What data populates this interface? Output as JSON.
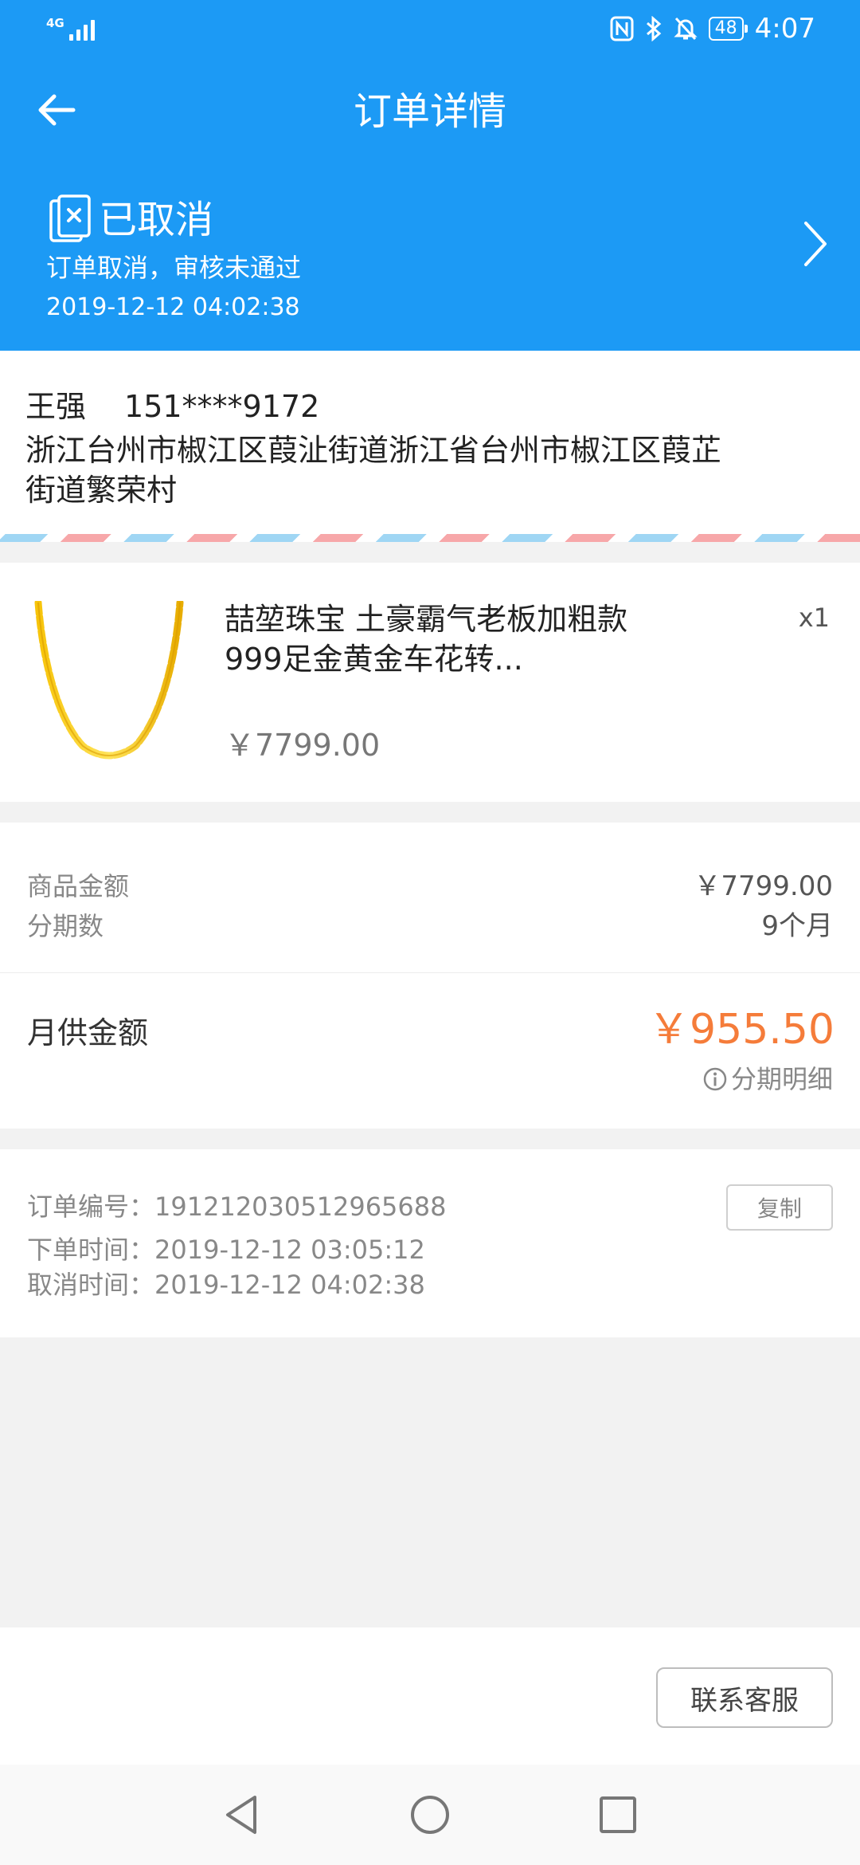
{
  "status_bar": {
    "network_label": "4G",
    "time": "4:07",
    "battery": "48",
    "icons": [
      "nfc-icon",
      "bluetooth-icon",
      "mute-icon",
      "battery-icon"
    ]
  },
  "header": {
    "title": "订单详情",
    "back_icon": "arrow-left-icon"
  },
  "order_status": {
    "title": "已取消",
    "reason": "订单取消，审核未通过",
    "time": "2019-12-12 04:02:38",
    "icon": "cancel-document-icon"
  },
  "address": {
    "name": "王强",
    "phone": "151****9172",
    "detail": "浙江台州市椒江区葭沚街道浙江省台州市椒江区葭芷街道繁荣村"
  },
  "product": {
    "name": "喆堃珠宝 土豪霸气老板加粗款999足金黄金车花转...",
    "quantity": "x1",
    "price": "￥7799.00",
    "image": "gold-necklace"
  },
  "amounts": {
    "goods_label": "商品金额",
    "goods_value": "￥7799.00",
    "installments_label": "分期数",
    "installments_value": "9个月",
    "monthly_label": "月供金额",
    "monthly_value": "￥955.50",
    "plan_detail_label": "分期明细"
  },
  "order_info": {
    "number_label": "订单编号：",
    "number_value": "191212030512965688",
    "created_label": "下单时间：",
    "created_value": "2019-12-12 03:05:12",
    "cancelled_label": "取消时间：",
    "cancelled_value": "2019-12-12 04:02:38",
    "copy_label": "复制"
  },
  "footer": {
    "contact_label": "联系客服"
  },
  "colors": {
    "primary": "#1c9af5",
    "accent": "#f57c3a",
    "background": "#f2f2f2"
  }
}
